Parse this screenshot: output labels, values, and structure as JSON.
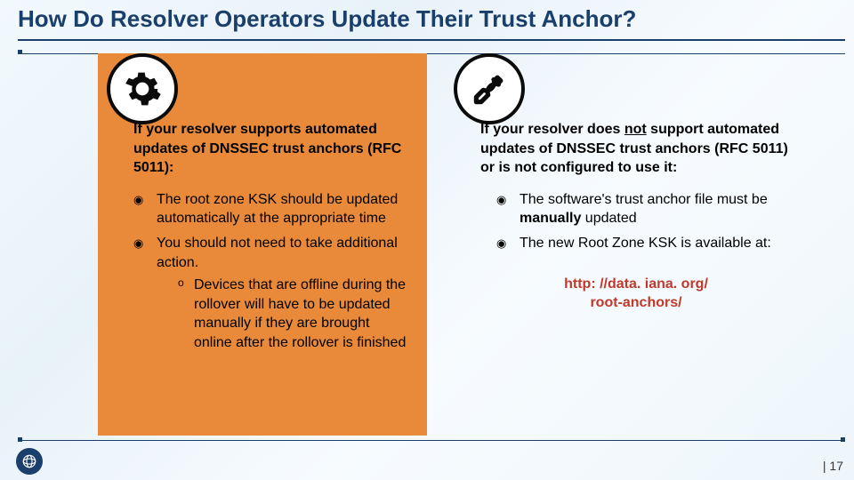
{
  "title": "How Do Resolver Operators Update Their Trust Anchor?",
  "left": {
    "icon": "gear-icon",
    "lead": "If your resolver supports automated updates of DNSSEC trust anchors (RFC 5011):",
    "b1": "The root zone KSK should be updated automatically at the appropriate time",
    "b2": "You should not need to take additional action.",
    "b2s1": "Devices that are offline during the rollover will have to be updated manually if they are brought online after the rollover is finished"
  },
  "right": {
    "icon": "wrench-icon",
    "lead_pre": "If your resolver does ",
    "lead_not": "not",
    "lead_post": " support automated updates of DNSSEC trust anchors (RFC 5011) or is not configured to use it:",
    "b1_pre": "The software's trust anchor file must be ",
    "b1_bold": "manually",
    "b1_post": " updated",
    "b2": "The new Root Zone KSK is available at:",
    "link1": "http: //data. iana. org/",
    "link2": "root-anchors/"
  },
  "page_prefix": "| ",
  "page_num": "17"
}
